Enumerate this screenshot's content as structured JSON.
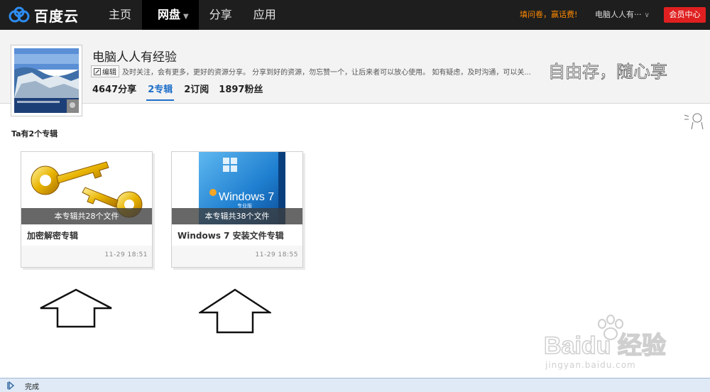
{
  "app": {
    "logo_text": "百度云"
  },
  "nav": {
    "items": [
      {
        "label": "主页"
      },
      {
        "label": "网盘"
      },
      {
        "label": "分享"
      },
      {
        "label": "应用"
      }
    ],
    "notice": "填问卷，赢话费!",
    "user": "电脑人人有···",
    "vip_button": "会员中心"
  },
  "profile": {
    "name": "电脑人人有经验",
    "edit_label": "编辑",
    "description": "及时关注，会有更多，更好的资源分享。 分享到好的资源，勿忘赞一个，让后来者可以放心使用。 如有疑虑，及时沟通，可以关...",
    "slogan": "自由存，随心享",
    "stats": [
      {
        "label": "4647分享"
      },
      {
        "label": "2专辑"
      },
      {
        "label": "2订阅"
      },
      {
        "label": "1897粉丝"
      }
    ]
  },
  "albums_section": {
    "title": "Ta有2个专辑",
    "albums": [
      {
        "overlay": "本专辑共28个文件",
        "title": "加密解密专辑",
        "date": "11-29  18:51",
        "thumb_icon": "golden-keys"
      },
      {
        "overlay": "本专辑共38个文件",
        "title": "Windows 7 安装文件专辑",
        "date": "11-29  18:55",
        "thumb_icon": "windows-7-box"
      }
    ]
  },
  "watermark": {
    "text": "jingyan.baidu.com",
    "logo": "Baidu 经验"
  },
  "statusbar": {
    "text": "完成"
  },
  "colors": {
    "accent": "#1e6fc9",
    "vip": "#e02020",
    "notice": "#ff8a00",
    "topbar": "#1e1e1e"
  }
}
